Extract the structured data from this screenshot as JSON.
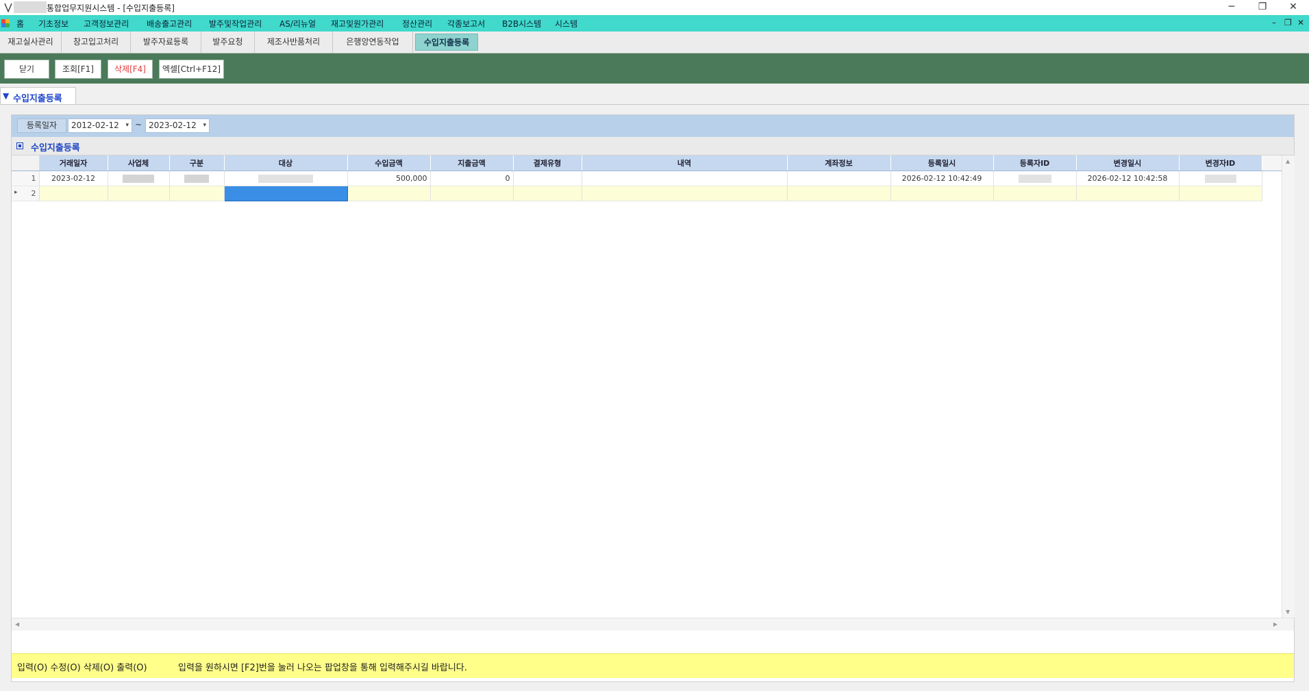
{
  "window": {
    "title": "통합업무지원시스템 - [수입지출등록]",
    "minimize_glyph": "─",
    "restore_glyph": "❐",
    "close_glyph": "✕"
  },
  "menubar": {
    "items": [
      "홈",
      "기초정보",
      "고객정보관리",
      "배송출고관리",
      "발주및작업관리",
      "AS/리뉴얼",
      "재고및원가관리",
      "정산관리",
      "각종보고서",
      "B2B시스템",
      "시스템"
    ],
    "mdi_minimize": "–",
    "mdi_restore": "❐",
    "mdi_close": "✕"
  },
  "tabs": [
    "재고실사관리",
    "창고입고처리",
    "발주자료등록",
    "발주요청",
    "제조사반품처리",
    "은행앙연동작업",
    "수입지출등록"
  ],
  "active_tab": "수입지출등록",
  "toolbar": {
    "close": "닫기",
    "search": "조회[F1]",
    "delete": "삭제[F4]",
    "excel": "엑셀[Ctrl+F12]"
  },
  "section": {
    "title": "수입지출등록"
  },
  "filter": {
    "label": "등록일자",
    "date_from": "2012-02-12",
    "date_to": "2023-02-12",
    "separator": "~",
    "caret": "▾"
  },
  "grid": {
    "title": "수입지출등록",
    "columns": [
      "거래일자",
      "사업체",
      "구분",
      "대상",
      "수입금액",
      "지출금액",
      "결제유형",
      "내역",
      "계좌정보",
      "등록일시",
      "등록자ID",
      "변경일시",
      "변경자ID"
    ],
    "rows": [
      {
        "no": "1",
        "trade_date": "2023-02-12",
        "income": "500,000",
        "expense": "0",
        "payment_type": "",
        "detail": "",
        "account": "",
        "reg_time": "2026-02-12 10:42:49",
        "mod_time": "2026-02-12 10:42:58"
      }
    ],
    "new_row": {
      "no": "2",
      "indicator": "▸"
    }
  },
  "status": {
    "permissions": "입력(O) 수정(O) 삭제(O) 출력(O)",
    "message": "입력을 원하시면 [F2]번을 눌러 나오는 팝업창을 통해 입력해주시길 바랍니다."
  },
  "colors": {
    "menubar": "#40d9cc",
    "toolbar": "#4a7a59",
    "accent_blue": "#1e44c8",
    "selected_cell": "#3a8ee6",
    "new_row": "#fdfdd7",
    "status_bar": "#ffff8a",
    "delete_text": "#e23b3b"
  }
}
